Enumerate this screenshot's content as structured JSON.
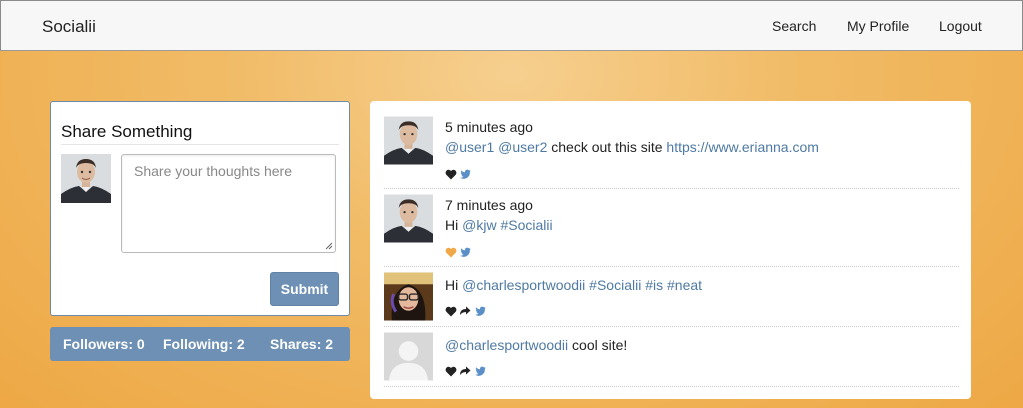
{
  "navbar": {
    "brand": "Socialii",
    "links": [
      "Search",
      "My Profile",
      "Logout"
    ]
  },
  "share": {
    "title": "Share Something",
    "placeholder": "Share your thoughts here",
    "submit_label": "Submit"
  },
  "stats": {
    "followers": "Followers: 0",
    "following": "Following: 2",
    "shares": "Shares: 2"
  },
  "feed": {
    "posts": [
      {
        "time": "5 minutes ago",
        "parts": [
          {
            "text": "@user1",
            "link": true
          },
          {
            "text": " ",
            "link": false
          },
          {
            "text": "@user2",
            "link": true
          },
          {
            "text": " check out this site ",
            "link": false
          },
          {
            "text": "https://www.erianna.com",
            "link": true
          }
        ],
        "heart_color": "#222",
        "show_share": false
      },
      {
        "time": "7 minutes ago",
        "parts": [
          {
            "text": "Hi ",
            "link": false
          },
          {
            "text": "@kjw",
            "link": true
          },
          {
            "text": " ",
            "link": false
          },
          {
            "text": "#Socialii",
            "link": true
          }
        ],
        "heart_color": "#f0a848",
        "show_share": false
      },
      {
        "time": "",
        "parts": [
          {
            "text": "Hi ",
            "link": false
          },
          {
            "text": "@charlesportwoodii",
            "link": true
          },
          {
            "text": " ",
            "link": false
          },
          {
            "text": "#Socialii",
            "link": true
          },
          {
            "text": " ",
            "link": false
          },
          {
            "text": "#is",
            "link": true
          },
          {
            "text": " ",
            "link": false
          },
          {
            "text": "#neat",
            "link": true
          }
        ],
        "heart_color": "#222",
        "show_share": true
      },
      {
        "time": "",
        "parts": [
          {
            "text": "@charlesportwoodii",
            "link": true
          },
          {
            "text": " cool site!",
            "link": false
          }
        ],
        "heart_color": "#222",
        "show_share": true
      }
    ]
  },
  "colors": {
    "accent": "#6d90b4",
    "link": "#4f7aa3",
    "twitter": "#5b8fc7",
    "background": "#f1bb66"
  },
  "icons": {
    "heart": "heart-icon",
    "share": "share-arrow-icon",
    "twitter": "twitter-icon"
  }
}
